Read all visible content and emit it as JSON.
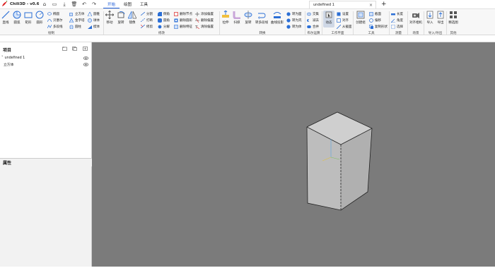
{
  "app": {
    "title": "Chili3D - v0.6"
  },
  "menu": {
    "tabs": [
      "开始",
      "绘图",
      "工具"
    ]
  },
  "document_tab": {
    "title": "undefined 1",
    "close": "×",
    "add": "+"
  },
  "ribbon": {
    "draw": {
      "label": "绘制",
      "big": [
        "直线",
        "圆弧",
        "矩形",
        "圆形"
      ],
      "small": [
        "椭圆",
        "贝塞尔",
        "多段线",
        "立方体",
        "金字塔",
        "圆柱",
        "圆锥",
        "球体",
        "楔体"
      ]
    },
    "modify": {
      "label": "修改",
      "big": [
        "移动",
        "旋转",
        "镜像"
      ],
      "small": [
        "分割",
        "打断",
        "修剪",
        "倒角",
        "圆角",
        "分解",
        "删除节点",
        "删除圆形",
        "删除特征",
        "添加偏置",
        "删除偏置",
        "清除偏置"
      ]
    },
    "convert": {
      "label": "转换",
      "big": [
        "拉伸",
        "扫掠",
        "旋转",
        "转多段线",
        "曲线投影"
      ],
      "small": [
        "转为面",
        "转为壳",
        "转为体"
      ]
    },
    "boolean": {
      "label": "布尔运算",
      "small": [
        "交集",
        "减去",
        "合并"
      ]
    },
    "workplane": {
      "label": "工作平面",
      "big": [
        "动态"
      ],
      "small": [
        "设置",
        "对齐",
        "从截面"
      ]
    },
    "tools": {
      "label": "工具",
      "big": [
        "创建组"
      ],
      "small": [
        "截面",
        "偏移",
        "复制形状"
      ]
    },
    "measure": {
      "label": "测量",
      "small": [
        "长度",
        "角度",
        "选择"
      ]
    },
    "scene": {
      "label": "场景",
      "big": [
        "对齐相机"
      ]
    },
    "io": {
      "label": "导入/导出",
      "big": [
        "导入",
        "导出"
      ]
    },
    "other": {
      "label": "其他",
      "big": [
        "精选图"
      ]
    }
  },
  "project_panel": {
    "title": "项目",
    "items": [
      {
        "label": "undefined 1",
        "level": 0
      },
      {
        "label": "立方体",
        "level": 1
      }
    ]
  },
  "properties_panel": {
    "title": "属性"
  },
  "colors": {
    "accent": "#1a5ad8",
    "viewport": "#7b7b7b",
    "box_front": "#c4c4c4",
    "box_top": "#d6d6d6",
    "box_side": "#b3b3b3"
  }
}
